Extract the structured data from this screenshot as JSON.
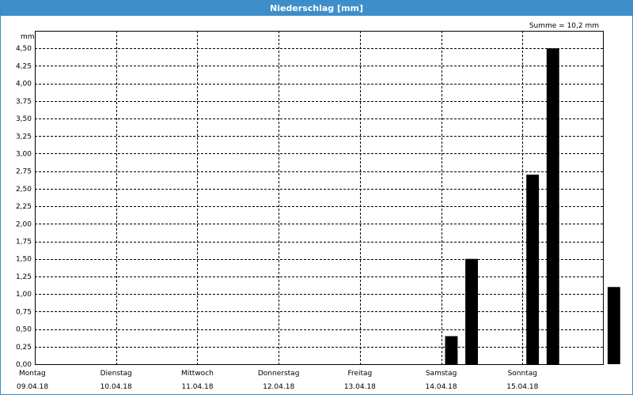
{
  "window": {
    "title": "Niederschlag [mm]"
  },
  "chart_data": {
    "type": "bar",
    "title": "Niederschlag [mm]",
    "ylabel": "mm",
    "ylim": [
      0,
      4.75
    ],
    "grid": true,
    "annotation": "Summe = 10,2 mm",
    "x_days": [
      {
        "day": "Montag",
        "date": "09.04.18"
      },
      {
        "day": "Dienstag",
        "date": "10.04.18"
      },
      {
        "day": "Mittwoch",
        "date": "11.04.18"
      },
      {
        "day": "Donnerstag",
        "date": "12.04.18"
      },
      {
        "day": "Freitag",
        "date": "13.04.18"
      },
      {
        "day": "Samstag",
        "date": "14.04.18"
      },
      {
        "day": "Sonntag",
        "date": "15.04.18"
      }
    ],
    "y_ticks": [
      "0,00",
      "0,25",
      "0,50",
      "0,75",
      "1,00",
      "1,25",
      "1,50",
      "1,75",
      "2,00",
      "2,25",
      "2,50",
      "2,75",
      "3,00",
      "3,25",
      "3,50",
      "3,75",
      "4,00",
      "4,25",
      "4,50"
    ],
    "bars": [
      {
        "start": "14.04.18 00:00",
        "end": "14.04.18 06:00",
        "value": 0.4
      },
      {
        "start": "14.04.18 06:00",
        "end": "14.04.18 12:00",
        "value": 1.5
      },
      {
        "start": "15.04.18 00:00",
        "end": "15.04.18 06:00",
        "value": 2.7
      },
      {
        "start": "15.04.18 06:00",
        "end": "15.04.18 12:00",
        "value": 4.5
      },
      {
        "start": "16.04.18 00:00",
        "end": "16.04.18 06:00",
        "value": 1.1
      }
    ],
    "colors": {
      "bar": "#000000",
      "title_bar": "#3e8ec9",
      "grid": "#000000"
    }
  }
}
